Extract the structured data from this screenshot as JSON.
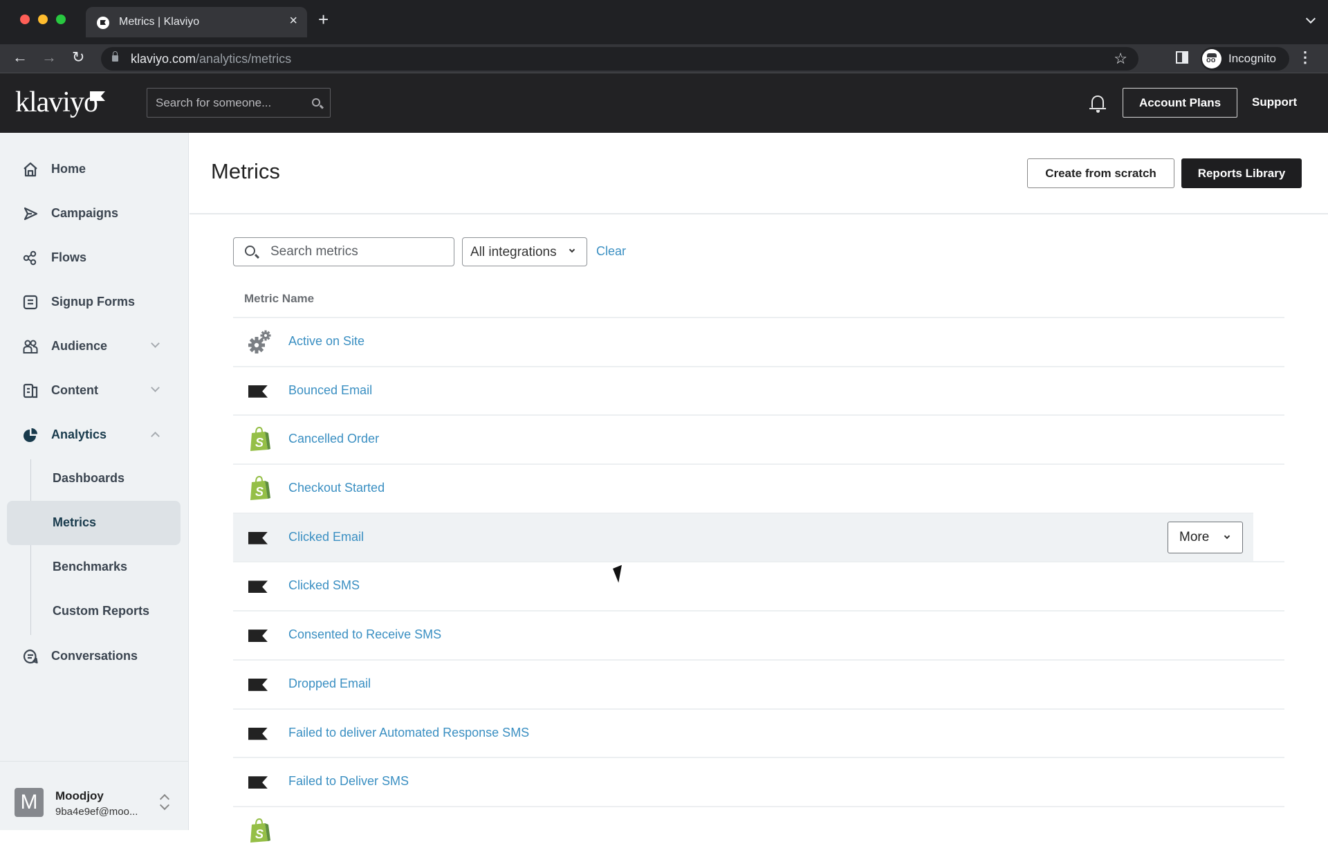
{
  "browser": {
    "tab_title": "Metrics | Klaviyo",
    "url_domain": "klaviyo.com",
    "url_path": "/analytics/metrics",
    "profile_label": "Incognito"
  },
  "header": {
    "logo_text": "klaviyo",
    "search_placeholder": "Search for someone...",
    "account_plans_label": "Account Plans",
    "support_label": "Support"
  },
  "sidebar": {
    "items": [
      {
        "label": "Home",
        "icon": "home-icon"
      },
      {
        "label": "Campaigns",
        "icon": "send-icon"
      },
      {
        "label": "Flows",
        "icon": "flows-icon"
      },
      {
        "label": "Signup Forms",
        "icon": "form-icon"
      },
      {
        "label": "Audience",
        "icon": "audience-icon",
        "expandable": true
      },
      {
        "label": "Content",
        "icon": "content-icon",
        "expandable": true
      },
      {
        "label": "Analytics",
        "icon": "analytics-pie-icon",
        "expandable": true,
        "expanded": true
      },
      {
        "label": "Conversations",
        "icon": "chat-icon"
      }
    ],
    "analytics_subitems": [
      {
        "label": "Dashboards"
      },
      {
        "label": "Metrics",
        "selected": true
      },
      {
        "label": "Benchmarks"
      },
      {
        "label": "Custom Reports"
      }
    ],
    "account": {
      "initial": "M",
      "name": "Moodjoy",
      "email": "9ba4e9ef@moo..."
    }
  },
  "main": {
    "title": "Metrics",
    "create_button_label": "Create from scratch",
    "library_button_label": "Reports Library",
    "search_placeholder": "Search metrics",
    "integration_filter": "All integrations",
    "clear_label": "Clear",
    "column_header": "Metric Name",
    "more_button_label": "More",
    "metrics": [
      {
        "name": "Active on Site",
        "source": "api-gears"
      },
      {
        "name": "Bounced Email",
        "source": "klaviyo"
      },
      {
        "name": "Cancelled Order",
        "source": "shopify"
      },
      {
        "name": "Checkout Started",
        "source": "shopify"
      },
      {
        "name": "Clicked Email",
        "source": "klaviyo",
        "hovered": true
      },
      {
        "name": "Clicked SMS",
        "source": "klaviyo"
      },
      {
        "name": "Consented to Receive SMS",
        "source": "klaviyo"
      },
      {
        "name": "Dropped Email",
        "source": "klaviyo"
      },
      {
        "name": "Failed to deliver Automated Response SMS",
        "source": "klaviyo"
      },
      {
        "name": "Failed to Deliver SMS",
        "source": "klaviyo"
      },
      {
        "name": "",
        "source": "shopify"
      }
    ]
  },
  "colors": {
    "link": "#3a8fc2",
    "header_bg": "#222224",
    "sidebar_bg": "#eff2f4",
    "shopify_green": "#95bf47",
    "primary_button": "#1e1e20"
  }
}
